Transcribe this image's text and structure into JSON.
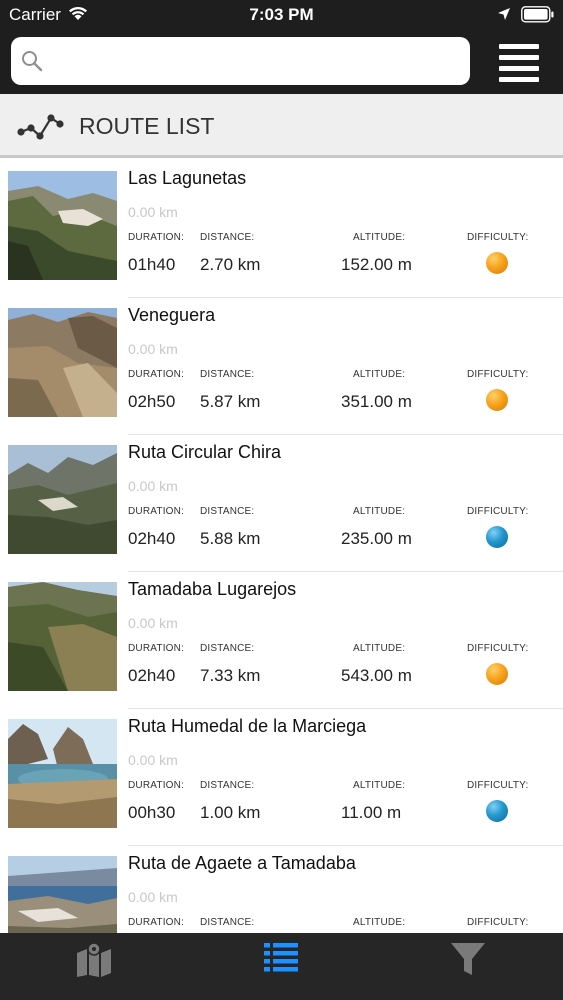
{
  "status_bar": {
    "carrier": "Carrier",
    "time": "7:03 PM"
  },
  "search": {
    "placeholder": "",
    "value": ""
  },
  "section": {
    "title": "ROUTE LIST",
    "icon": "route-icon"
  },
  "labels": {
    "duration": "DURATION:",
    "distance": "DISTANCE:",
    "altitude": "ALTITUDE:",
    "difficulty": "DIFFICULTY:"
  },
  "colors": {
    "difficulty_orange": "#f7a21c",
    "difficulty_blue": "#2396cc",
    "active_tab": "#1e90ff"
  },
  "routes": [
    {
      "name": "Las Lagunetas",
      "km": "0.00 km",
      "duration": "01h40",
      "distance": "2.70 km",
      "altitude": "152.00 m",
      "difficulty": "orange"
    },
    {
      "name": "Veneguera",
      "km": "0.00 km",
      "duration": "02h50",
      "distance": "5.87 km",
      "altitude": "351.00 m",
      "difficulty": "orange"
    },
    {
      "name": "Ruta Circular Chira",
      "km": "0.00 km",
      "duration": "02h40",
      "distance": "5.88 km",
      "altitude": "235.00 m",
      "difficulty": "blue"
    },
    {
      "name": "Tamadaba Lugarejos",
      "km": "0.00 km",
      "duration": "02h40",
      "distance": "7.33 km",
      "altitude": "543.00 m",
      "difficulty": "orange"
    },
    {
      "name": "Ruta Humedal de la Marciega",
      "km": "0.00 km",
      "duration": "00h30",
      "distance": "1.00 km",
      "altitude": "11.00 m",
      "difficulty": "blue"
    },
    {
      "name": "Ruta de Agaete a Tamadaba",
      "km": "0.00 km",
      "duration": "",
      "distance": "",
      "altitude": "",
      "difficulty": ""
    }
  ],
  "tabs": [
    {
      "icon": "map-icon",
      "active": false
    },
    {
      "icon": "list-icon",
      "active": true
    },
    {
      "icon": "filter-icon",
      "active": false
    }
  ]
}
